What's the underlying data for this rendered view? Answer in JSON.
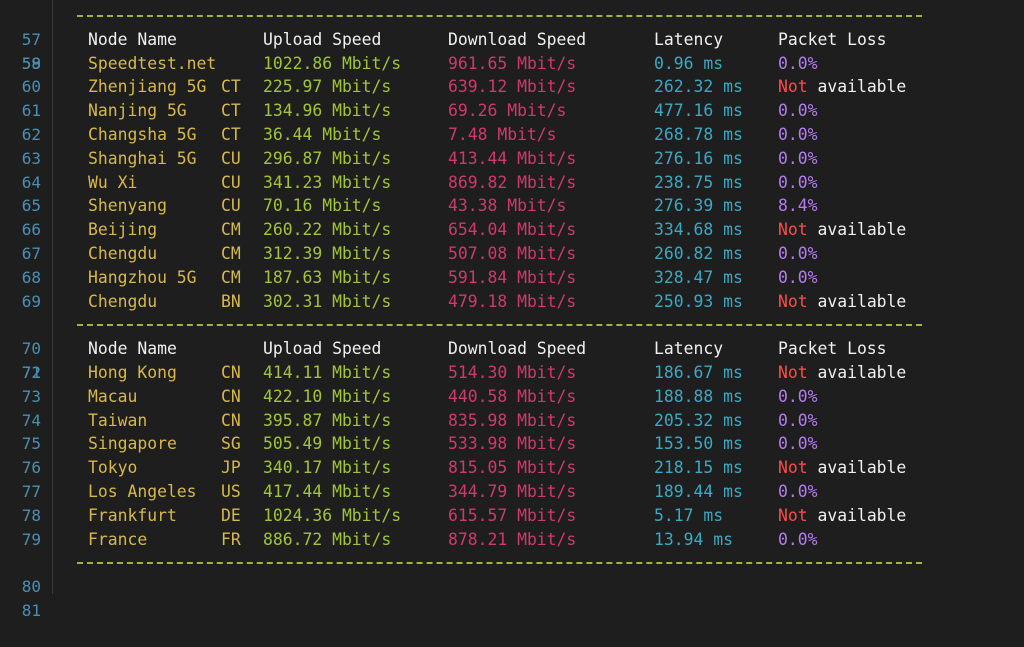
{
  "colors": {
    "background": "#1e1e1e",
    "line_number": "#4a8fb4",
    "separator": "#9ab93a",
    "header": "#f0f0f0",
    "node_name": "#d7b84a",
    "upload": "#a0c43a",
    "download": "#d0396f",
    "latency": "#3ba9c4",
    "packet_loss": "#b57cf0",
    "not_available_red": "#ff4a4a"
  },
  "table1": {
    "line_numbers": {
      "sep_top": "57",
      "header": "58",
      "sep_bottom": "70"
    },
    "header": {
      "node": "Node Name",
      "upload": "Upload Speed",
      "download": "Download Speed",
      "latency": "Latency",
      "loss": "Packet Loss"
    },
    "rows": [
      {
        "ln": "59",
        "name": "Speedtest.net",
        "code": "",
        "up": "1022.86 Mbit/s",
        "down": "961.65 Mbit/s",
        "lat": "0.96 ms",
        "loss": "0.0%"
      },
      {
        "ln": "60",
        "name": "Zhenjiang 5G",
        "code": "CT",
        "up": "225.97 Mbit/s",
        "down": "639.12 Mbit/s",
        "lat": "262.32 ms",
        "loss": "Not available"
      },
      {
        "ln": "61",
        "name": "Nanjing 5G",
        "code": "CT",
        "up": "134.96 Mbit/s",
        "down": "69.26 Mbit/s",
        "lat": "477.16 ms",
        "loss": "0.0%"
      },
      {
        "ln": "62",
        "name": "Changsha 5G",
        "code": "CT",
        "up": "36.44 Mbit/s",
        "down": "7.48 Mbit/s",
        "lat": "268.78 ms",
        "loss": "0.0%"
      },
      {
        "ln": "63",
        "name": "Shanghai 5G",
        "code": "CU",
        "up": "296.87 Mbit/s",
        "down": "413.44 Mbit/s",
        "lat": "276.16 ms",
        "loss": "0.0%"
      },
      {
        "ln": "64",
        "name": "Wu Xi",
        "code": "CU",
        "up": "341.23 Mbit/s",
        "down": "869.82 Mbit/s",
        "lat": "238.75 ms",
        "loss": "0.0%"
      },
      {
        "ln": "65",
        "name": "Shenyang",
        "code": "CU",
        "up": "70.16 Mbit/s",
        "down": "43.38 Mbit/s",
        "lat": "276.39 ms",
        "loss": "8.4%"
      },
      {
        "ln": "66",
        "name": "Beijing",
        "code": "CM",
        "up": "260.22 Mbit/s",
        "down": "654.04 Mbit/s",
        "lat": "334.68 ms",
        "loss": "Not available"
      },
      {
        "ln": "67",
        "name": "Chengdu",
        "code": "CM",
        "up": "312.39 Mbit/s",
        "down": "507.08 Mbit/s",
        "lat": "260.82 ms",
        "loss": "0.0%"
      },
      {
        "ln": "68",
        "name": "Hangzhou 5G",
        "code": "CM",
        "up": "187.63 Mbit/s",
        "down": "591.84 Mbit/s",
        "lat": "328.47 ms",
        "loss": "0.0%"
      },
      {
        "ln": "69",
        "name": "Chengdu",
        "code": "BN",
        "up": "302.31 Mbit/s",
        "down": "479.18 Mbit/s",
        "lat": "250.93 ms",
        "loss": "Not available"
      }
    ]
  },
  "table2": {
    "line_numbers": {
      "header": "71",
      "sep_bottom": "80",
      "trailing": "81"
    },
    "header": {
      "node": "Node Name",
      "upload": "Upload Speed",
      "download": "Download Speed",
      "latency": "Latency",
      "loss": "Packet Loss"
    },
    "rows": [
      {
        "ln": "72",
        "name": "Hong Kong",
        "code": "CN",
        "up": "414.11 Mbit/s",
        "down": "514.30 Mbit/s",
        "lat": "186.67 ms",
        "loss": "Not available"
      },
      {
        "ln": "73",
        "name": "Macau",
        "code": "CN",
        "up": "422.10 Mbit/s",
        "down": "440.58 Mbit/s",
        "lat": "188.88 ms",
        "loss": "0.0%"
      },
      {
        "ln": "74",
        "name": "Taiwan",
        "code": "CN",
        "up": "395.87 Mbit/s",
        "down": "835.98 Mbit/s",
        "lat": "205.32 ms",
        "loss": "0.0%"
      },
      {
        "ln": "75",
        "name": "Singapore",
        "code": "SG",
        "up": "505.49 Mbit/s",
        "down": "533.98 Mbit/s",
        "lat": "153.50 ms",
        "loss": "0.0%"
      },
      {
        "ln": "76",
        "name": "Tokyo",
        "code": "JP",
        "up": "340.17 Mbit/s",
        "down": "815.05 Mbit/s",
        "lat": "218.15 ms",
        "loss": "Not available"
      },
      {
        "ln": "77",
        "name": "Los Angeles",
        "code": "US",
        "up": "417.44 Mbit/s",
        "down": "344.79 Mbit/s",
        "lat": "189.44 ms",
        "loss": "0.0%"
      },
      {
        "ln": "78",
        "name": "Frankfurt",
        "code": "DE",
        "up": "1024.36 Mbit/s",
        "down": "615.57 Mbit/s",
        "lat": "5.17 ms",
        "loss": "Not available"
      },
      {
        "ln": "79",
        "name": "France",
        "code": "FR",
        "up": "886.72 Mbit/s",
        "down": "878.21 Mbit/s",
        "lat": "13.94 ms",
        "loss": "0.0%"
      }
    ]
  }
}
